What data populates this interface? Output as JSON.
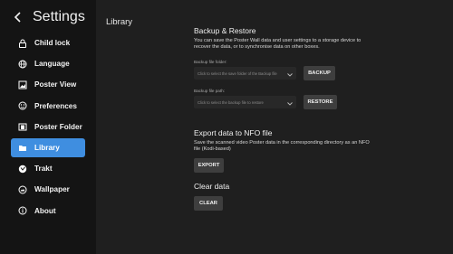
{
  "sidebar": {
    "title": "Settings",
    "back_icon": "back-arrow-icon",
    "items": [
      {
        "label": "Child lock",
        "icon": "lock-icon"
      },
      {
        "label": "Language",
        "icon": "globe-icon"
      },
      {
        "label": "Poster View",
        "icon": "image-icon"
      },
      {
        "label": "Preferences",
        "icon": "preferences-icon"
      },
      {
        "label": "Poster Folder",
        "icon": "folder-icon"
      },
      {
        "label": "Library",
        "icon": "library-icon",
        "active": true
      },
      {
        "label": "Trakt",
        "icon": "trakt-icon"
      },
      {
        "label": "Wallpaper",
        "icon": "wallpaper-icon"
      },
      {
        "label": "About",
        "icon": "info-icon"
      }
    ]
  },
  "main": {
    "page_title": "Library",
    "backup": {
      "title": "Backup & Restore",
      "description": "You can save the Poster Wall data and user settings to a storage device to recover the data, or to synchronise data on other boxes.",
      "folder_label": "Backup file folder:",
      "folder_placeholder": "Click to select the save folder of the Backup file",
      "backup_button": "BACKUP",
      "path_label": "Backup file path:",
      "path_placeholder": "Click to select the backup file to restore",
      "restore_button": "RESTORE"
    },
    "nfo": {
      "title": "Export data to NFO file",
      "description": "Save the scanned video Poster data in the corresponding directory as an NFO file (Kodi-based)",
      "export_button": "EXPORT"
    },
    "clear": {
      "title": "Clear data",
      "clear_button": "CLEAR"
    }
  },
  "colors": {
    "accent": "#3f8ee0",
    "sidebar_bg": "#141414",
    "main_bg": "#1f1f1f"
  }
}
